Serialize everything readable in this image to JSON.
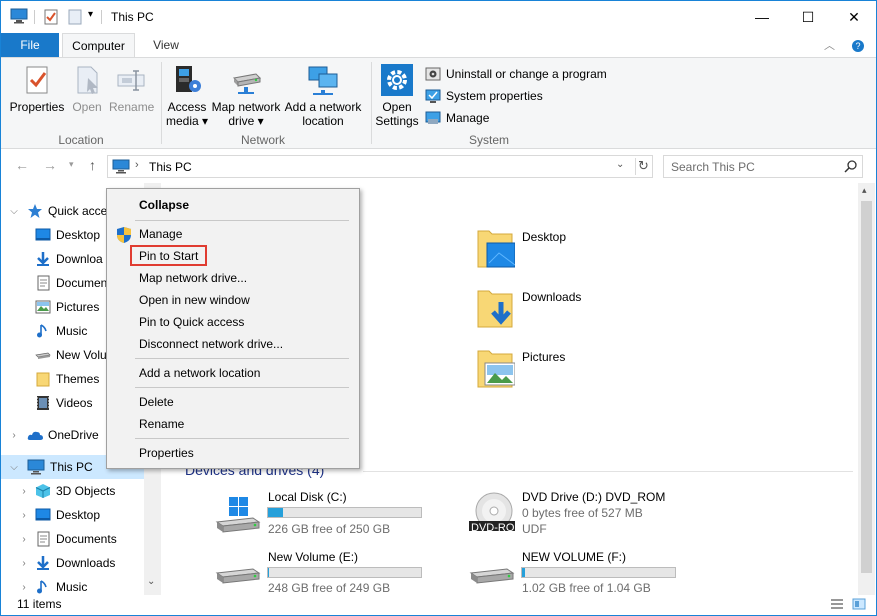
{
  "window": {
    "title": "This PC",
    "controls": {
      "minimize": "—",
      "maximize": "☐",
      "close": "✕"
    }
  },
  "ribbon": {
    "tabs": {
      "file": "File",
      "computer": "Computer",
      "view": "View"
    },
    "location": {
      "label": "Location",
      "properties": "Properties",
      "open": "Open",
      "rename": "Rename"
    },
    "network": {
      "label": "Network",
      "access_media_1": "Access",
      "access_media_2": "media ▾",
      "map_drive_1": "Map network",
      "map_drive_2": "drive ▾",
      "add_location_1": "Add a network",
      "add_location_2": "location"
    },
    "system": {
      "label": "System",
      "open_settings_1": "Open",
      "open_settings_2": "Settings",
      "uninstall": "Uninstall or change a program",
      "system_properties": "System properties",
      "manage": "Manage"
    }
  },
  "address": {
    "path": "This PC",
    "search_placeholder": "Search This PC"
  },
  "nav": {
    "quick_access": "Quick acce",
    "items": [
      "Desktop",
      "Downloa",
      "Documen",
      "Pictures",
      "Music",
      "New Volu",
      "Themes",
      "Videos"
    ],
    "onedrive": "OneDrive",
    "this_pc": "This PC",
    "pc_items": [
      "3D Objects",
      "Desktop",
      "Documents",
      "Downloads",
      "Music"
    ]
  },
  "folders": [
    "Desktop",
    "Downloads",
    "Pictures"
  ],
  "devices": {
    "heading": "Devices and drives (4)",
    "drives": [
      {
        "name": "Local Disk (C:)",
        "free": "226 GB free of 250 GB",
        "used_fraction": 0.096
      },
      {
        "name": "DVD Drive (D:) DVD_ROM",
        "free": "0 bytes free of 527 MB",
        "fs": "UDF",
        "badge": "DVD-ROM"
      },
      {
        "name": "New Volume (E:)",
        "free": "248 GB free of 249 GB",
        "used_fraction": 0.004
      },
      {
        "name": "NEW VOLUME (F:)",
        "free": "1.02 GB free of 1.04 GB",
        "used_fraction": 0.02
      }
    ]
  },
  "context_menu": {
    "collapse": "Collapse",
    "manage": "Manage",
    "pin_to_start": "Pin to Start",
    "map_network_drive": "Map network drive...",
    "open_new_window": "Open in new window",
    "pin_quick_access": "Pin to Quick access",
    "disconnect": "Disconnect network drive...",
    "add_network_location": "Add a network location",
    "delete": "Delete",
    "rename": "Rename",
    "properties": "Properties"
  },
  "status": {
    "items": "11 items"
  },
  "colors": {
    "accent": "#1979ca",
    "folder": "#f8d775",
    "selection": "#cce8ff",
    "highlight": "#e03c31",
    "drive_fill": "#26a0da"
  }
}
